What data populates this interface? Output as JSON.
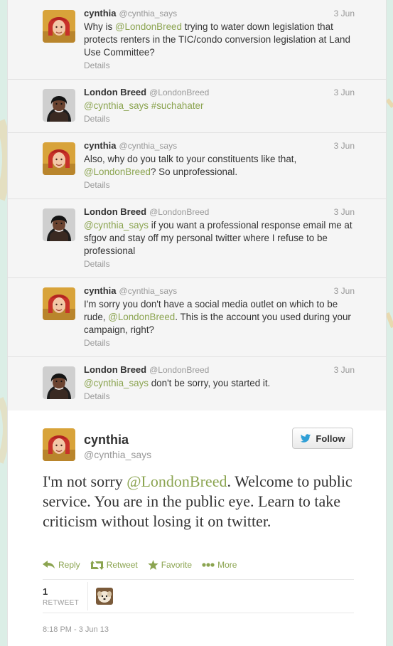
{
  "colors": {
    "link": "#8ba450",
    "name": "#333333",
    "muted": "#999999",
    "follow_icon": "#2f9fd6"
  },
  "conversation": [
    {
      "name": "cynthia",
      "handle": "@cynthia_says",
      "date": "3 Jun",
      "avatar": "avatar-cynthia",
      "text_parts": [
        {
          "text": "Why is "
        },
        {
          "text": "@LondonBreed",
          "mention": true
        },
        {
          "text": " trying to water down legislation that protects renters in the TIC/condo conversion legislation at Land Use Committee?"
        }
      ],
      "details": "Details"
    },
    {
      "name": "London Breed",
      "handle": "@LondonBreed",
      "date": "3 Jun",
      "avatar": "avatar-london",
      "text_parts": [
        {
          "text": "@cynthia_says",
          "mention": true
        },
        {
          "text": " "
        },
        {
          "text": "#suchahater",
          "mention": true
        }
      ],
      "details": "Details"
    },
    {
      "name": "cynthia",
      "handle": "@cynthia_says",
      "date": "3 Jun",
      "avatar": "avatar-cynthia",
      "text_parts": [
        {
          "text": "Also, why do you talk to your constituents like that, "
        },
        {
          "text": "@LondonBreed",
          "mention": true
        },
        {
          "text": "? So unprofessional."
        }
      ],
      "details": "Details"
    },
    {
      "name": "London Breed",
      "handle": "@LondonBreed",
      "date": "3 Jun",
      "avatar": "avatar-london",
      "text_parts": [
        {
          "text": "@cynthia_says",
          "mention": true
        },
        {
          "text": " if you want a professional response email me at sfgov and stay off my personal twitter where I refuse to be professional"
        }
      ],
      "details": "Details"
    },
    {
      "name": "cynthia",
      "handle": "@cynthia_says",
      "date": "3 Jun",
      "avatar": "avatar-cynthia",
      "text_parts": [
        {
          "text": "I'm sorry you don't have a social media outlet on which to be rude, "
        },
        {
          "text": "@LondonBreed",
          "mention": true
        },
        {
          "text": ". This is the account you used during your campaign, right?"
        }
      ],
      "details": "Details"
    },
    {
      "name": "London Breed",
      "handle": "@LondonBreed",
      "date": "3 Jun",
      "avatar": "avatar-london",
      "text_parts": [
        {
          "text": "@cynthia_says",
          "mention": true
        },
        {
          "text": " don't be sorry, you started it."
        }
      ],
      "details": "Details"
    }
  ],
  "main_tweet": {
    "name": "cynthia",
    "handle": "@cynthia_says",
    "follow_label": "Follow",
    "text_parts": [
      {
        "text": "I'm not sorry "
      },
      {
        "text": "@LondonBreed",
        "mention": true
      },
      {
        "text": ". Welcome to public service. You are in the public eye. Learn to take criticism without losing it on twitter."
      }
    ],
    "actions": [
      {
        "label": "Reply",
        "icon": "reply-icon"
      },
      {
        "label": "Retweet",
        "icon": "retweet-icon"
      },
      {
        "label": "Favorite",
        "icon": "star-icon"
      },
      {
        "label": "More",
        "icon": "more-icon"
      }
    ],
    "retweet_count": "1",
    "retweet_label": "RETWEET",
    "timestamp": "8:18 PM - 3 Jun 13"
  }
}
